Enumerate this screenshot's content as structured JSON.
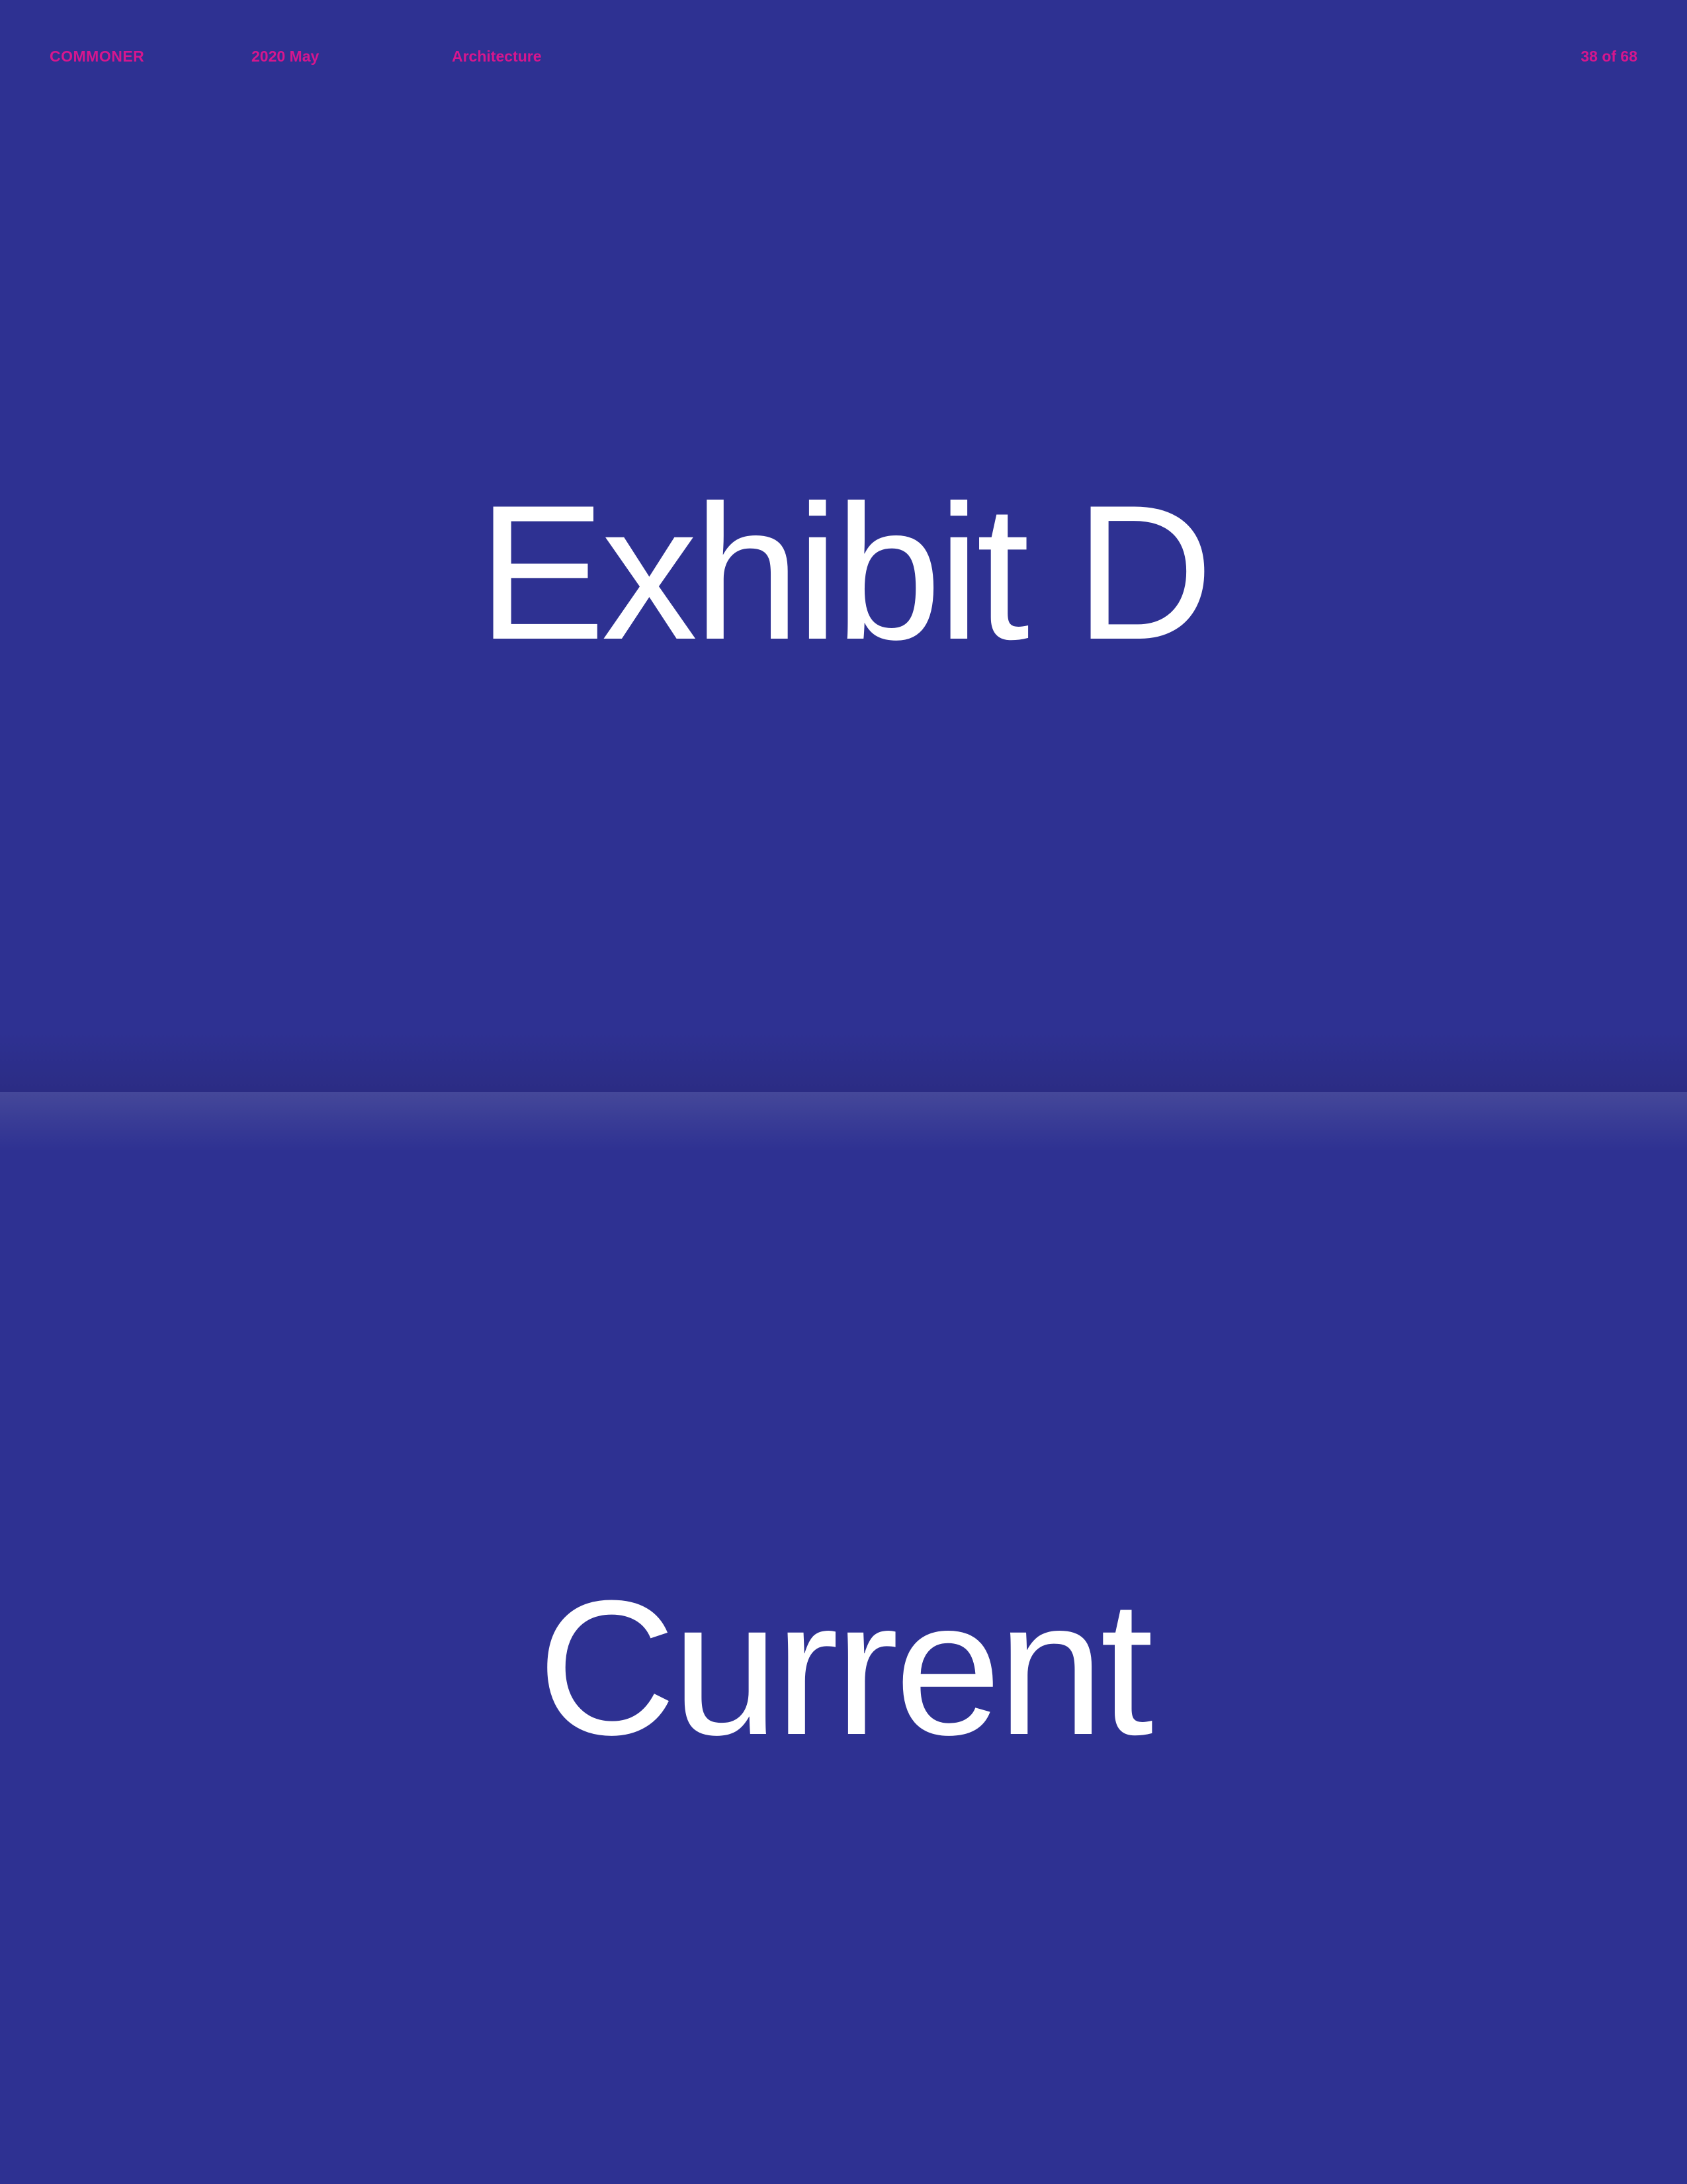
{
  "header": {
    "brand": "COMMONER",
    "date": "2020 May",
    "section": "Architecture",
    "page_indicator": "38 of 68"
  },
  "exhibit": {
    "title": "Exhibit D",
    "subtitle": "Current"
  },
  "colors": {
    "background": "#2e3192",
    "accent": "#d6168e",
    "text": "#ffffff"
  }
}
